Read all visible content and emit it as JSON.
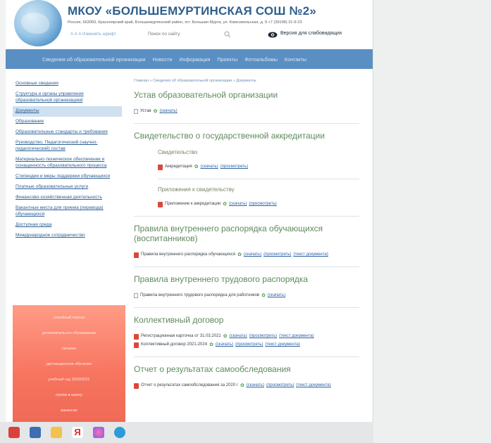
{
  "header": {
    "school_title": "МКОУ «БОЛЬШЕМУРТИНСКАЯ СОШ №2»",
    "address": "Россия, 663060, Красноярский край, Большемуртинский район, пгт. Большая Мурта, ул. Комсомольская, д. 9       +7 (39198) 31-9-23",
    "resize_links": "А  А  А   Изменить шрифт",
    "search_placeholder": "Поиск по сайту",
    "vision_label": "Версия для слабовидящих"
  },
  "nav": {
    "items": [
      "Сведения об образовательной организации",
      "Новости",
      "Информация",
      "Проекты",
      "Фотоальбомы",
      "Контакты"
    ]
  },
  "sidebar": {
    "items": [
      "Основные сведения",
      "Структура и органы управления образовательной организацией",
      "Документы",
      "Образование",
      "Образовательные стандарты и требования",
      "Руководство. Педагогический (научно-педагогический) состав",
      "Материально-техническое обеспечение и оснащенность образовательного процесса",
      "Стипендии и меры поддержки обучающихся",
      "Платные образовательные услуги",
      "Финансово-хозяйственная деятельность",
      "Вакантные места для приема (перевода) обучающихся",
      "Доступная среда",
      "Международное сотрудничество"
    ],
    "active_index": 2
  },
  "promo": {
    "items": [
      "семейный портал",
      "дополнительное образование",
      "питание",
      "дистанционное обучение",
      "учебный год 2020/2021",
      "приём в школу",
      "вакансии"
    ]
  },
  "main": {
    "breadcrumb": "Главная » Сведения об образовательной организации » Документы",
    "sections": [
      {
        "title": "Устав образовательной организации"
      },
      {
        "title": "Свидетельство о государственной аккредитации",
        "sub1": "Свидетельство",
        "sub2": "Приложения к свидетельству"
      },
      {
        "title": "Правила внутреннего распорядка обучающихся (воспитанников)"
      },
      {
        "title": "Правила внутреннего трудового распорядка"
      },
      {
        "title": "Коллективный договор"
      },
      {
        "title": "Отчет о результатах самообследования"
      }
    ],
    "docs": {
      "ustav": "Устав",
      "accred": "Аккредитация",
      "prilozh": "Приложение к аккредитации",
      "pravila_ob": "Правила внутреннего распорядка обучающихся",
      "pravila_trud": "Правила внутреннего трудового распорядка для работников",
      "reg_card": "Регистрационная карточка от 31.03.2021",
      "koll_dog": "Коллективный договор 2021-2024",
      "otchet": "Отчет о результатах самообследования за 2020 г"
    },
    "links": {
      "download": "(скачать)",
      "view": "(просмотреть)",
      "text_doc": "(текст документа)"
    }
  },
  "taskbar": {
    "apps": [
      "pdf-app-icon",
      "photos-icon",
      "folder-icon",
      "yandex-icon",
      "color-app-icon",
      "edge-icon"
    ]
  }
}
